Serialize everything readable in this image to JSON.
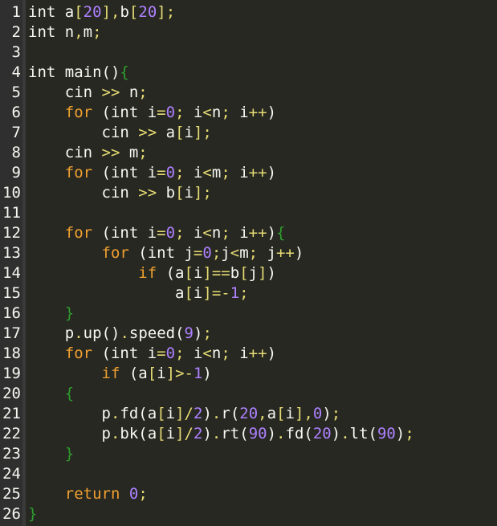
{
  "editor": {
    "lines": [
      {
        "number": "1",
        "tokens": [
          {
            "t": "int ",
            "k": "id"
          },
          {
            "t": "a",
            "k": "id"
          },
          {
            "t": "[",
            "k": "op"
          },
          {
            "t": "20",
            "k": "num"
          },
          {
            "t": "]",
            "k": "op"
          },
          {
            "t": ",",
            "k": "op"
          },
          {
            "t": "b",
            "k": "id"
          },
          {
            "t": "[",
            "k": "op"
          },
          {
            "t": "20",
            "k": "num"
          },
          {
            "t": "]",
            "k": "op"
          },
          {
            "t": ";",
            "k": "op"
          }
        ]
      },
      {
        "number": "2",
        "tokens": [
          {
            "t": "int ",
            "k": "id"
          },
          {
            "t": "n",
            "k": "id"
          },
          {
            "t": ",",
            "k": "op"
          },
          {
            "t": "m",
            "k": "id"
          },
          {
            "t": ";",
            "k": "op"
          }
        ]
      },
      {
        "number": "3",
        "tokens": []
      },
      {
        "number": "4",
        "tokens": [
          {
            "t": "int ",
            "k": "id"
          },
          {
            "t": "main",
            "k": "id"
          },
          {
            "t": "()",
            "k": "pun"
          },
          {
            "t": "{",
            "k": "brace"
          }
        ]
      },
      {
        "number": "5",
        "tokens": [
          {
            "t": "    cin ",
            "k": "id"
          },
          {
            "t": ">>",
            "k": "op"
          },
          {
            "t": " n",
            "k": "id"
          },
          {
            "t": ";",
            "k": "op"
          }
        ]
      },
      {
        "number": "6",
        "tokens": [
          {
            "t": "    ",
            "k": "ws"
          },
          {
            "t": "for",
            "k": "kw"
          },
          {
            "t": " (int i",
            "k": "id"
          },
          {
            "t": "=",
            "k": "op"
          },
          {
            "t": "0",
            "k": "num"
          },
          {
            "t": "; ",
            "k": "op"
          },
          {
            "t": "i",
            "k": "id"
          },
          {
            "t": "<",
            "k": "op"
          },
          {
            "t": "n",
            "k": "id"
          },
          {
            "t": "; ",
            "k": "op"
          },
          {
            "t": "i",
            "k": "id"
          },
          {
            "t": "++",
            "k": "op"
          },
          {
            "t": ")",
            "k": "pun"
          }
        ]
      },
      {
        "number": "7",
        "tokens": [
          {
            "t": "        cin ",
            "k": "id"
          },
          {
            "t": ">>",
            "k": "op"
          },
          {
            "t": " a",
            "k": "id"
          },
          {
            "t": "[",
            "k": "op"
          },
          {
            "t": "i",
            "k": "id"
          },
          {
            "t": "]",
            "k": "op"
          },
          {
            "t": ";",
            "k": "op"
          }
        ]
      },
      {
        "number": "8",
        "tokens": [
          {
            "t": "    cin ",
            "k": "id"
          },
          {
            "t": ">>",
            "k": "op"
          },
          {
            "t": " m",
            "k": "id"
          },
          {
            "t": ";",
            "k": "op"
          }
        ]
      },
      {
        "number": "9",
        "tokens": [
          {
            "t": "    ",
            "k": "ws"
          },
          {
            "t": "for",
            "k": "kw"
          },
          {
            "t": " (int i",
            "k": "id"
          },
          {
            "t": "=",
            "k": "op"
          },
          {
            "t": "0",
            "k": "num"
          },
          {
            "t": "; ",
            "k": "op"
          },
          {
            "t": "i",
            "k": "id"
          },
          {
            "t": "<",
            "k": "op"
          },
          {
            "t": "m",
            "k": "id"
          },
          {
            "t": "; ",
            "k": "op"
          },
          {
            "t": "i",
            "k": "id"
          },
          {
            "t": "++",
            "k": "op"
          },
          {
            "t": ")",
            "k": "pun"
          }
        ]
      },
      {
        "number": "10",
        "tokens": [
          {
            "t": "        cin ",
            "k": "id"
          },
          {
            "t": ">>",
            "k": "op"
          },
          {
            "t": " b",
            "k": "id"
          },
          {
            "t": "[",
            "k": "op"
          },
          {
            "t": "i",
            "k": "id"
          },
          {
            "t": "]",
            "k": "op"
          },
          {
            "t": ";",
            "k": "op"
          }
        ]
      },
      {
        "number": "11",
        "tokens": []
      },
      {
        "number": "12",
        "tokens": [
          {
            "t": "    ",
            "k": "ws"
          },
          {
            "t": "for",
            "k": "kw"
          },
          {
            "t": " (int i",
            "k": "id"
          },
          {
            "t": "=",
            "k": "op"
          },
          {
            "t": "0",
            "k": "num"
          },
          {
            "t": "; ",
            "k": "op"
          },
          {
            "t": "i",
            "k": "id"
          },
          {
            "t": "<",
            "k": "op"
          },
          {
            "t": "n",
            "k": "id"
          },
          {
            "t": "; ",
            "k": "op"
          },
          {
            "t": "i",
            "k": "id"
          },
          {
            "t": "++",
            "k": "op"
          },
          {
            "t": ")",
            "k": "pun"
          },
          {
            "t": "{",
            "k": "brace"
          }
        ]
      },
      {
        "number": "13",
        "tokens": [
          {
            "t": "        ",
            "k": "ws"
          },
          {
            "t": "for",
            "k": "kw"
          },
          {
            "t": " (int j",
            "k": "id"
          },
          {
            "t": "=",
            "k": "op"
          },
          {
            "t": "0",
            "k": "num"
          },
          {
            "t": ";",
            "k": "op"
          },
          {
            "t": "j",
            "k": "id"
          },
          {
            "t": "<",
            "k": "op"
          },
          {
            "t": "m",
            "k": "id"
          },
          {
            "t": "; ",
            "k": "op"
          },
          {
            "t": "j",
            "k": "id"
          },
          {
            "t": "++",
            "k": "op"
          },
          {
            "t": ")",
            "k": "pun"
          }
        ]
      },
      {
        "number": "14",
        "tokens": [
          {
            "t": "            ",
            "k": "ws"
          },
          {
            "t": "if",
            "k": "kw"
          },
          {
            "t": " (a",
            "k": "id"
          },
          {
            "t": "[",
            "k": "op"
          },
          {
            "t": "i",
            "k": "id"
          },
          {
            "t": "]==",
            "k": "op"
          },
          {
            "t": "b",
            "k": "id"
          },
          {
            "t": "[",
            "k": "op"
          },
          {
            "t": "j",
            "k": "id"
          },
          {
            "t": "]",
            "k": "op"
          },
          {
            "t": ")",
            "k": "pun"
          }
        ]
      },
      {
        "number": "15",
        "tokens": [
          {
            "t": "                a",
            "k": "id"
          },
          {
            "t": "[",
            "k": "op"
          },
          {
            "t": "i",
            "k": "id"
          },
          {
            "t": "]=-",
            "k": "op"
          },
          {
            "t": "1",
            "k": "num"
          },
          {
            "t": ";",
            "k": "op"
          }
        ]
      },
      {
        "number": "16",
        "tokens": [
          {
            "t": "    ",
            "k": "ws"
          },
          {
            "t": "}",
            "k": "brace"
          }
        ]
      },
      {
        "number": "17",
        "tokens": [
          {
            "t": "    p",
            "k": "id"
          },
          {
            "t": ".",
            "k": "op"
          },
          {
            "t": "up",
            "k": "id"
          },
          {
            "t": "()",
            "k": "pun"
          },
          {
            "t": ".",
            "k": "op"
          },
          {
            "t": "speed",
            "k": "id"
          },
          {
            "t": "(",
            "k": "pun"
          },
          {
            "t": "9",
            "k": "num"
          },
          {
            "t": ")",
            "k": "pun"
          },
          {
            "t": ";",
            "k": "op"
          }
        ]
      },
      {
        "number": "18",
        "tokens": [
          {
            "t": "    ",
            "k": "ws"
          },
          {
            "t": "for",
            "k": "kw"
          },
          {
            "t": " (int i",
            "k": "id"
          },
          {
            "t": "=",
            "k": "op"
          },
          {
            "t": "0",
            "k": "num"
          },
          {
            "t": "; ",
            "k": "op"
          },
          {
            "t": "i",
            "k": "id"
          },
          {
            "t": "<",
            "k": "op"
          },
          {
            "t": "n",
            "k": "id"
          },
          {
            "t": "; ",
            "k": "op"
          },
          {
            "t": "i",
            "k": "id"
          },
          {
            "t": "++",
            "k": "op"
          },
          {
            "t": ")",
            "k": "pun"
          }
        ]
      },
      {
        "number": "19",
        "tokens": [
          {
            "t": "        ",
            "k": "ws"
          },
          {
            "t": "if",
            "k": "kw"
          },
          {
            "t": " (a",
            "k": "id"
          },
          {
            "t": "[",
            "k": "op"
          },
          {
            "t": "i",
            "k": "id"
          },
          {
            "t": "]>-",
            "k": "op"
          },
          {
            "t": "1",
            "k": "num"
          },
          {
            "t": ")",
            "k": "pun"
          }
        ]
      },
      {
        "number": "20",
        "tokens": [
          {
            "t": "    ",
            "k": "ws"
          },
          {
            "t": "{",
            "k": "brace"
          }
        ]
      },
      {
        "number": "21",
        "tokens": [
          {
            "t": "        p",
            "k": "id"
          },
          {
            "t": ".",
            "k": "op"
          },
          {
            "t": "fd",
            "k": "id"
          },
          {
            "t": "(",
            "k": "pun"
          },
          {
            "t": "a",
            "k": "id"
          },
          {
            "t": "[",
            "k": "op"
          },
          {
            "t": "i",
            "k": "id"
          },
          {
            "t": "]/",
            "k": "op"
          },
          {
            "t": "2",
            "k": "num"
          },
          {
            "t": ")",
            "k": "pun"
          },
          {
            "t": ".",
            "k": "op"
          },
          {
            "t": "r",
            "k": "id"
          },
          {
            "t": "(",
            "k": "pun"
          },
          {
            "t": "20",
            "k": "num"
          },
          {
            "t": ",",
            "k": "op"
          },
          {
            "t": "a",
            "k": "id"
          },
          {
            "t": "[",
            "k": "op"
          },
          {
            "t": "i",
            "k": "id"
          },
          {
            "t": "],",
            "k": "op"
          },
          {
            "t": "0",
            "k": "num"
          },
          {
            "t": ")",
            "k": "pun"
          },
          {
            "t": ";",
            "k": "op"
          }
        ]
      },
      {
        "number": "22",
        "tokens": [
          {
            "t": "        p",
            "k": "id"
          },
          {
            "t": ".",
            "k": "op"
          },
          {
            "t": "bk",
            "k": "id"
          },
          {
            "t": "(",
            "k": "pun"
          },
          {
            "t": "a",
            "k": "id"
          },
          {
            "t": "[",
            "k": "op"
          },
          {
            "t": "i",
            "k": "id"
          },
          {
            "t": "]/",
            "k": "op"
          },
          {
            "t": "2",
            "k": "num"
          },
          {
            "t": ")",
            "k": "pun"
          },
          {
            "t": ".",
            "k": "op"
          },
          {
            "t": "rt",
            "k": "id"
          },
          {
            "t": "(",
            "k": "pun"
          },
          {
            "t": "90",
            "k": "num"
          },
          {
            "t": ")",
            "k": "pun"
          },
          {
            "t": ".",
            "k": "op"
          },
          {
            "t": "fd",
            "k": "id"
          },
          {
            "t": "(",
            "k": "pun"
          },
          {
            "t": "20",
            "k": "num"
          },
          {
            "t": ")",
            "k": "pun"
          },
          {
            "t": ".",
            "k": "op"
          },
          {
            "t": "lt",
            "k": "id"
          },
          {
            "t": "(",
            "k": "pun"
          },
          {
            "t": "90",
            "k": "num"
          },
          {
            "t": ")",
            "k": "pun"
          },
          {
            "t": ";",
            "k": "op"
          }
        ]
      },
      {
        "number": "23",
        "tokens": [
          {
            "t": "    ",
            "k": "ws"
          },
          {
            "t": "}",
            "k": "brace"
          }
        ]
      },
      {
        "number": "24",
        "tokens": []
      },
      {
        "number": "25",
        "tokens": [
          {
            "t": "    ",
            "k": "ws"
          },
          {
            "t": "return",
            "k": "kw"
          },
          {
            "t": " ",
            "k": "ws"
          },
          {
            "t": "0",
            "k": "num"
          },
          {
            "t": ";",
            "k": "op"
          }
        ]
      },
      {
        "number": "26",
        "tokens": [
          {
            "t": "}",
            "k": "brace"
          }
        ]
      }
    ]
  }
}
